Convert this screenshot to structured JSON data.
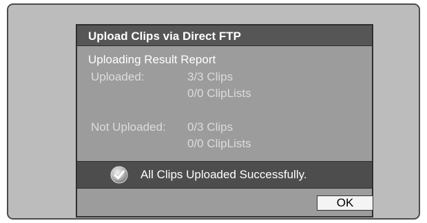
{
  "dialog": {
    "title": "Upload Clips via Direct FTP",
    "report_heading": "Uploading Result Report",
    "uploaded": {
      "label": "Uploaded:",
      "clips": "3/3 Clips",
      "cliplists": "0/0 ClipLists"
    },
    "not_uploaded": {
      "label": "Not Uploaded:",
      "clips": "0/3 Clips",
      "cliplists": "0/0 ClipLists"
    },
    "status": {
      "icon": "checkmark-icon",
      "message": "All Clips Uploaded Successfully."
    },
    "ok_label": "OK"
  },
  "colors": {
    "screen_bg": "#bcbcbc",
    "dialog_bg": "#9c9c9c",
    "title_bar_bg": "#565656",
    "status_bar_bg": "#4d4d4d",
    "dim_text": "#dcdcdc"
  }
}
